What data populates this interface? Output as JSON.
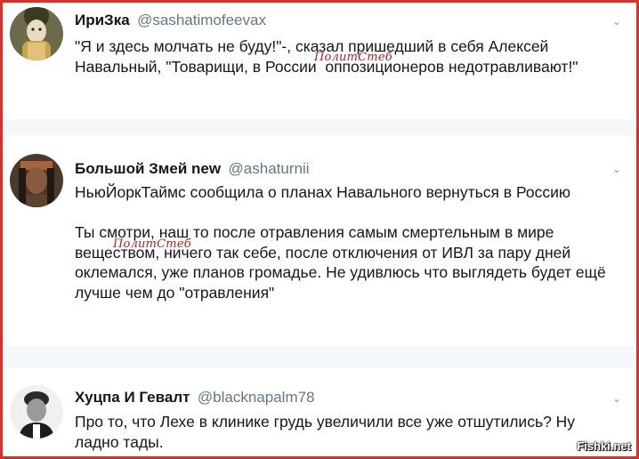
{
  "tweets": [
    {
      "name": "ИриЗка",
      "handle": "@sashatimofeevax",
      "text": "\"Я и здесь молчать не буду!\"-, сказал пришедший в себя Алексей\nНавальный, \"Товарищи, в России  оппозиционеров недотравливают!\""
    },
    {
      "name": "Большой Змей new",
      "handle": "@ashaturnii",
      "text": "НьюЙоркТаймс сообщила о планах Навального вернуться в Россию\n\nТы смотри, наш то после отравления самым смертельным в мире\nвеществом, ничего так себе, после отключения от ИВЛ за пару дней\nоклемался, уже планов громадье. Не удивлюсь что выглядеть будет ещё\nлучше чем до \"отравления\""
    },
    {
      "name": "Хуцпа И Гевалт",
      "handle": "@blacknapalm78",
      "text": "Про то, что Лехе в клинике грудь увеличили все уже отшутились? Ну\nладно тады."
    }
  ],
  "watermark": "ПолитСтеб",
  "site_badge": "Fishki.net",
  "menu_icon": "chevron-down-icon",
  "colors": {
    "frame": "#d9302a",
    "handle": "#657786",
    "text": "#14171a",
    "separator": "#e6ecf0",
    "watermark": "#b0201a"
  }
}
